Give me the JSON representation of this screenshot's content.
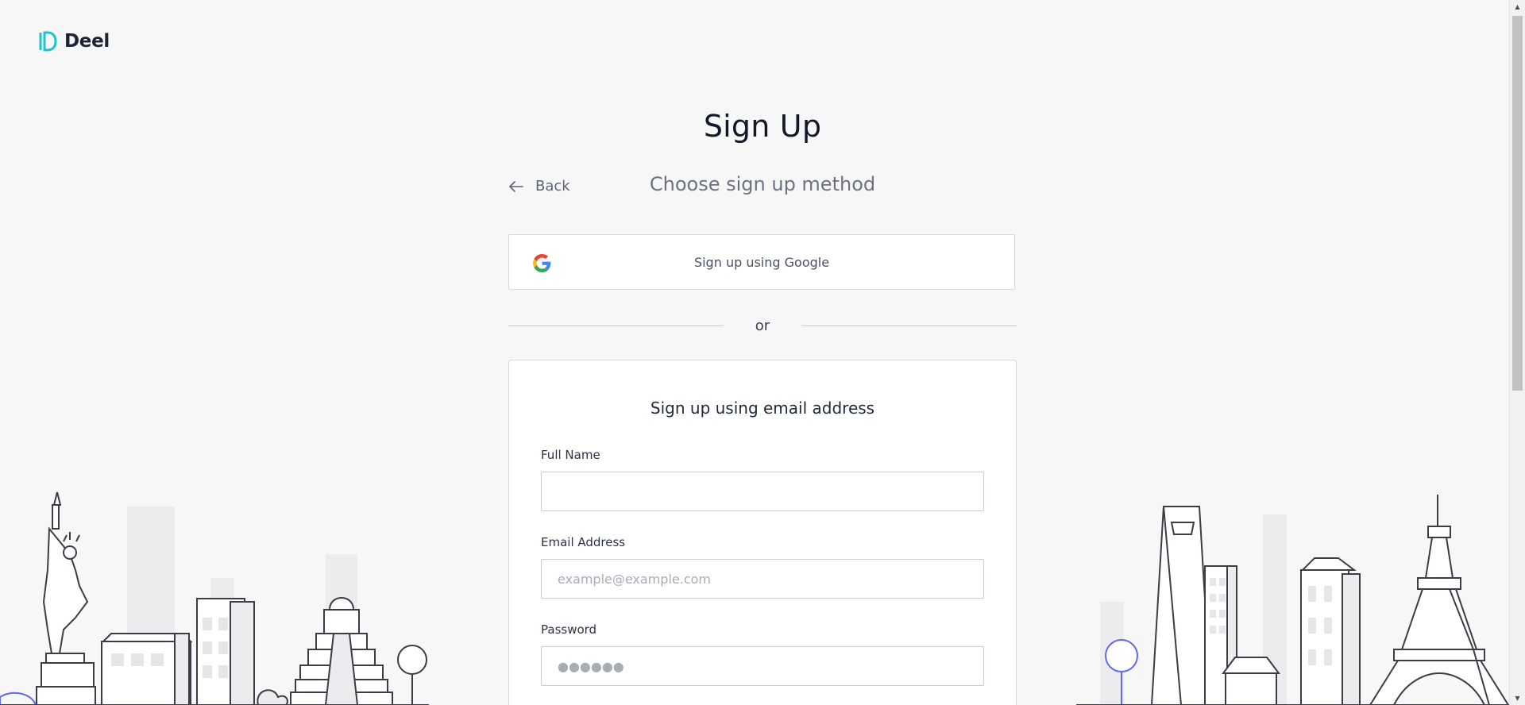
{
  "brand": {
    "name": "Deel",
    "accent": "#20c4c8"
  },
  "header": {
    "title": "Sign Up",
    "back_label": "Back",
    "subtitle": "Choose sign up method"
  },
  "google": {
    "label": "Sign up using Google",
    "icon": "google-icon"
  },
  "divider": {
    "text": "or"
  },
  "email_form": {
    "title": "Sign up using email address",
    "full_name": {
      "label": "Full Name",
      "value": "",
      "placeholder": ""
    },
    "email": {
      "label": "Email Address",
      "value": "",
      "placeholder": "example@example.com"
    },
    "password": {
      "label": "Password",
      "value": "",
      "placeholder": "●●●●●●"
    }
  },
  "decor": {
    "left_skyline": "new-york-skyline-illustration",
    "right_skyline": "shanghai-paris-skyline-illustration"
  },
  "scrollbar": {
    "up_icon": "arrow-up-icon",
    "down_icon": "arrow-down-icon",
    "up_glyph": "▲",
    "down_glyph": "▼"
  }
}
